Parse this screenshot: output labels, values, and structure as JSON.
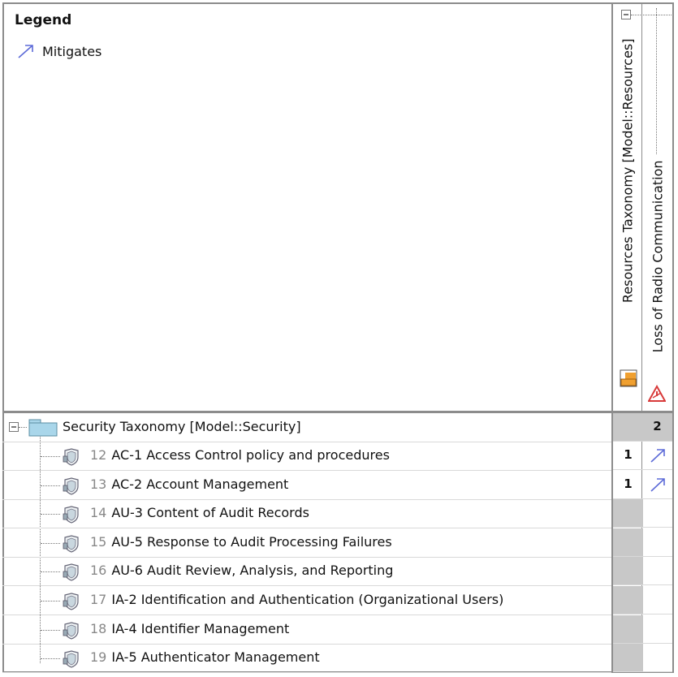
{
  "legend": {
    "title": "Legend",
    "items": [
      {
        "label": "Mitigates",
        "icon": "mitigates-arrow-icon",
        "color": "#5d6bd8"
      }
    ]
  },
  "columns": [
    {
      "label": "Resources Taxonomy [Model::Resources]",
      "icon": "resources-package-icon"
    },
    {
      "label": "Loss of Radio Communication",
      "icon": "hazard-icon"
    }
  ],
  "tree": {
    "root_label": "Security Taxonomy [Model::Security]",
    "root_icon": "folder-icon",
    "root_counts": [
      "",
      "2"
    ],
    "rows": [
      {
        "num": "12",
        "label": "AC-1 Access Control policy and procedures",
        "count": "1",
        "mitigates": true
      },
      {
        "num": "13",
        "label": "AC-2 Account Management",
        "count": "1",
        "mitigates": true
      },
      {
        "num": "14",
        "label": "AU-3 Content of Audit Records",
        "count": "",
        "mitigates": false
      },
      {
        "num": "15",
        "label": "AU-5 Response to Audit Processing Failures",
        "count": "",
        "mitigates": false
      },
      {
        "num": "16",
        "label": "AU-6 Audit Review, Analysis, and Reporting",
        "count": "",
        "mitigates": false
      },
      {
        "num": "17",
        "label": "IA-2 Identification and Authentication (Organizational Users)",
        "count": "",
        "mitigates": false
      },
      {
        "num": "18",
        "label": "IA-4 Identifier Management",
        "count": "",
        "mitigates": false
      },
      {
        "num": "19",
        "label": "IA-5 Authenticator Management",
        "count": "",
        "mitigates": false
      }
    ]
  },
  "colors": {
    "grid": "#8c8c8c",
    "grey_cell": "#c8c8c8",
    "arrow": "#5d6bd8",
    "folder": "#a9d6ea",
    "hazard": "#d83a3a",
    "package": "#f0a030"
  }
}
